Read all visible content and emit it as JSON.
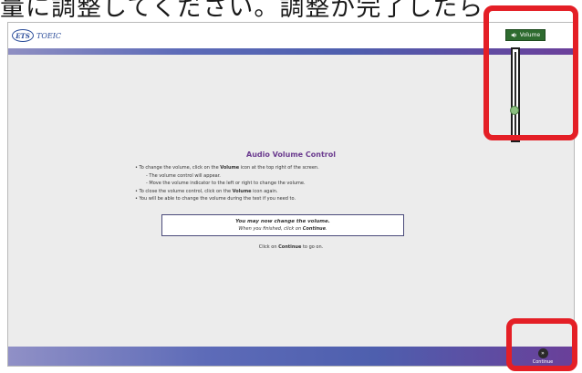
{
  "caption": "量に調整してください。調整が完了したら",
  "header": {
    "logo_ets": "ETS",
    "logo_text": "TOEIC",
    "volume_label": "Volume"
  },
  "volume": {
    "level": 0.3
  },
  "main": {
    "title": "Audio Volume Control",
    "bullets": [
      {
        "pre": "• To change the volume, click on the ",
        "bold": "Volume",
        "post": " icon at the top right of the screen."
      },
      {
        "pre": "- The volume control will appear.",
        "bold": "",
        "post": ""
      },
      {
        "pre": "- Move the volume indicator to the left or right to change the volume.",
        "bold": "",
        "post": ""
      },
      {
        "pre": "• To close the volume control, click on the ",
        "bold": "Volume",
        "post": " icon again."
      },
      {
        "pre": "• You will be able to change the volume during the test if you need to.",
        "bold": "",
        "post": ""
      }
    ],
    "notice": {
      "main": "You may now change the volume.",
      "sub_pre": "When you finished, click on ",
      "sub_bold": "Continue",
      "sub_post": "."
    },
    "continue_line": {
      "pre": "Click on ",
      "bold": "Continue",
      "post": " to go on."
    }
  },
  "footer": {
    "continue_label": "Continue"
  },
  "colors": {
    "highlight": "#e41f26",
    "title": "#6b3b8f",
    "volume_button": "#2e6b2f"
  }
}
